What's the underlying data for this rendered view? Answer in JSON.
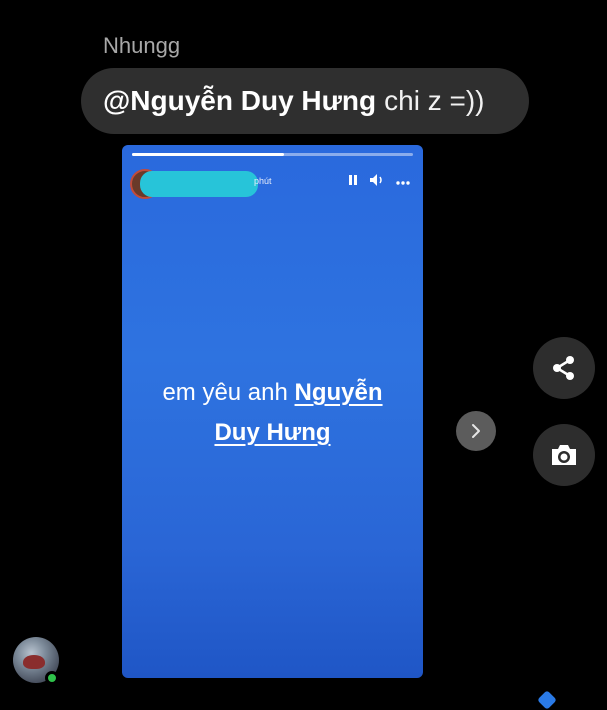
{
  "message": {
    "sender": "Nhungg",
    "mention": "@Nguyễn Duy Hưng",
    "text": "chi z =))"
  },
  "story": {
    "time": "phút",
    "text_prefix": "em yêu anh",
    "link_line1": "Nguyễn",
    "link_line2": "Duy Hưng",
    "progress": 0.54,
    "background_color": "#2e6fe0"
  },
  "icons": {
    "share": "share-icon",
    "camera": "camera-icon",
    "next": "chevron-right-icon",
    "pause": "pause-icon",
    "volume": "volume-icon",
    "more": "more-icon"
  },
  "colors": {
    "background": "#000000",
    "bubble": "#2f2f2f",
    "online": "#2fc24b",
    "redaction": "#27c4d9"
  }
}
